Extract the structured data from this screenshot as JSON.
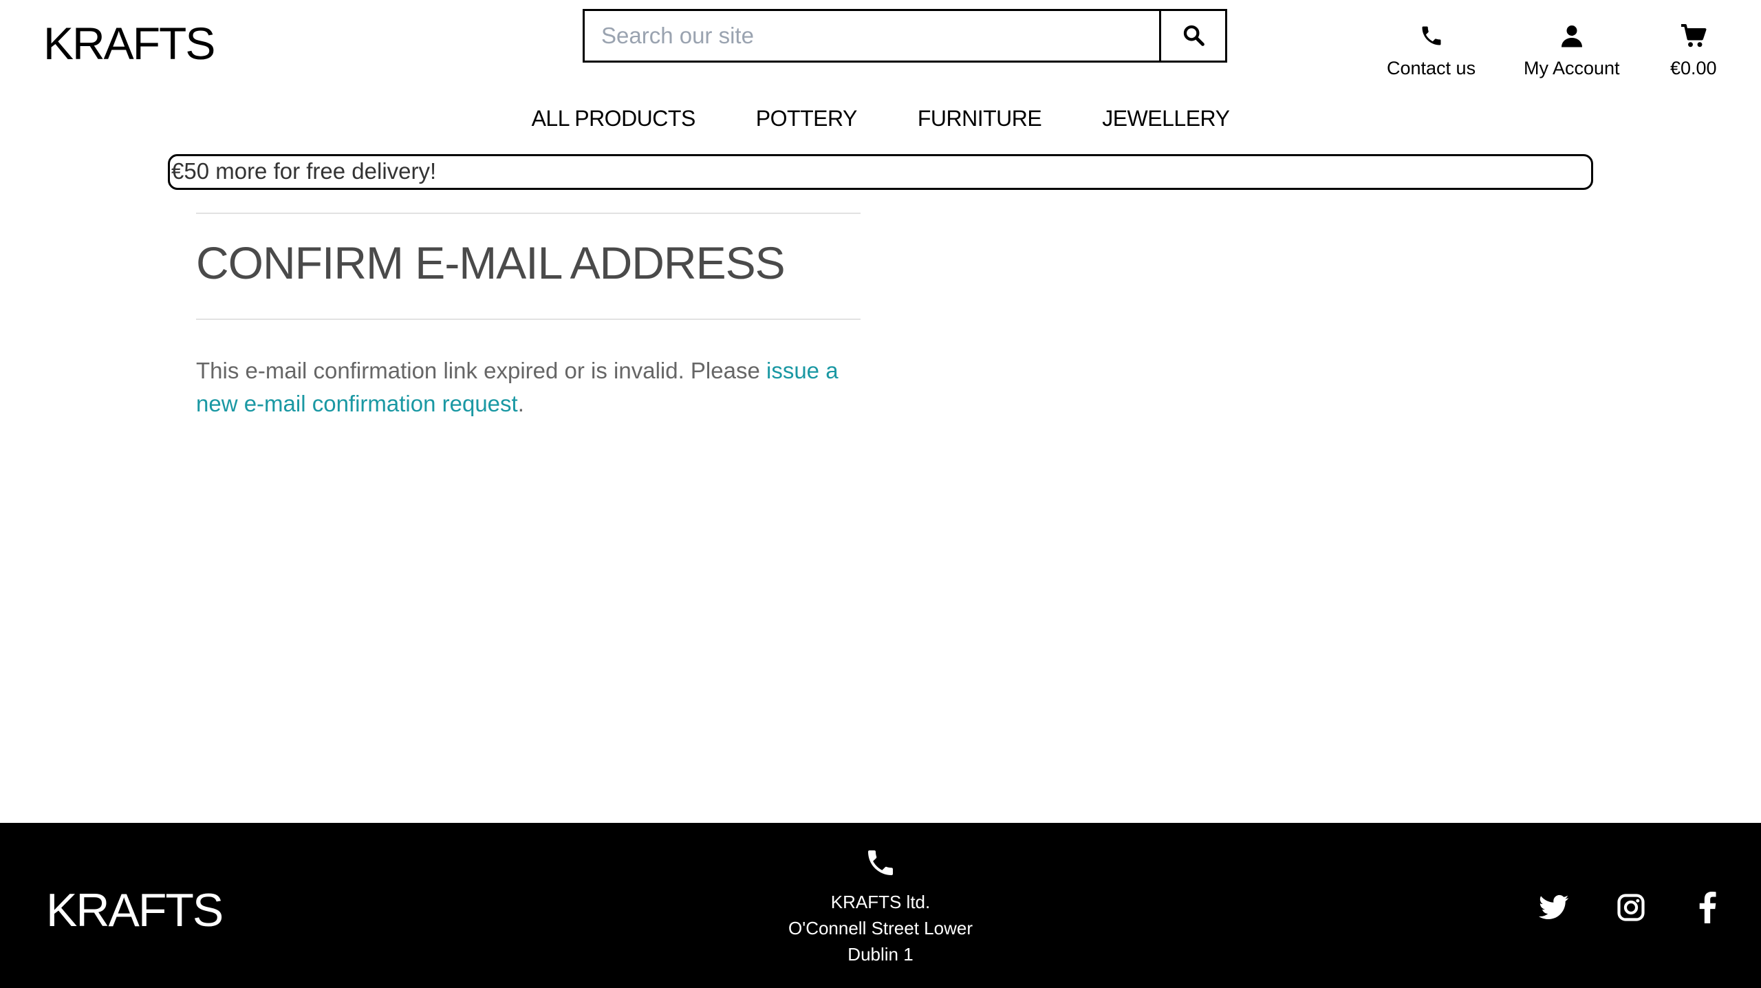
{
  "header": {
    "logo": "KRAFTS",
    "search_placeholder": "Search our site",
    "contact_label": "Contact us",
    "account_label": "My Account",
    "cart_total": "€0.00"
  },
  "nav": {
    "items": [
      "ALL PRODUCTS",
      "POTTERY",
      "FURNITURE",
      "JEWELLERY"
    ]
  },
  "banner": {
    "text": "€50 more for free delivery!"
  },
  "main": {
    "title": "CONFIRM E-MAIL ADDRESS",
    "message_prefix": "This e-mail confirmation link expired or is invalid. Please ",
    "message_link": "issue a new e-mail confirmation request",
    "message_suffix": "."
  },
  "footer": {
    "logo": "KRAFTS",
    "address_line1": "KRAFTS ltd.",
    "address_line2": "O'Connell Street Lower",
    "address_line3": "Dublin 1"
  },
  "colors": {
    "link": "#1a98a3",
    "footer_bg": "#000000",
    "title": "#4a4a4a"
  },
  "icons": {
    "search": "search-icon",
    "contact": "phone-icon",
    "account": "user-icon",
    "cart": "cart-icon",
    "footer_phone": "phone-icon",
    "twitter": "twitter-icon",
    "instagram": "instagram-icon",
    "facebook": "facebook-icon"
  }
}
